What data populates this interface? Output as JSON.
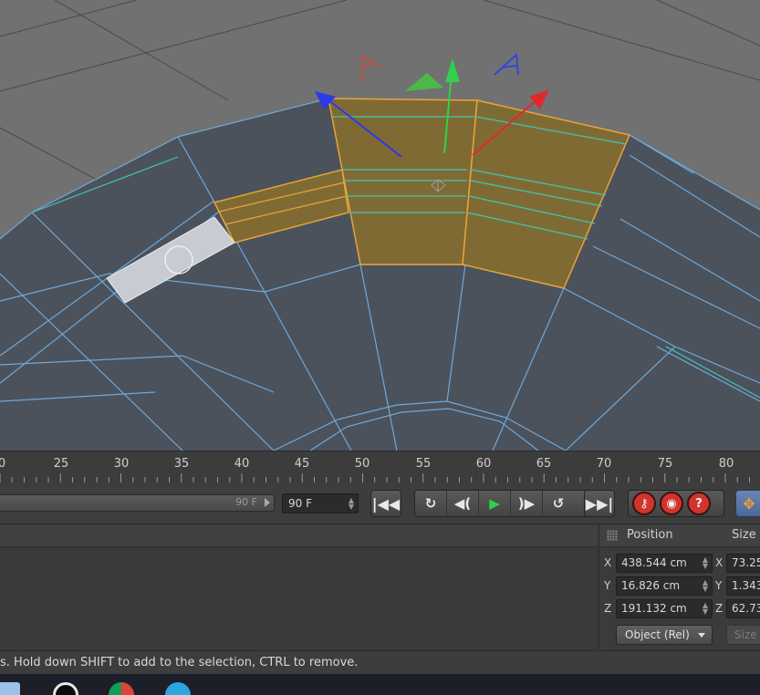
{
  "timeline": {
    "tick_labels": [
      "0",
      "25",
      "30",
      "35",
      "40",
      "45",
      "50",
      "55",
      "60",
      "65",
      "70",
      "75",
      "80"
    ]
  },
  "transport": {
    "slider_value": "90 F",
    "end_frame": "90 F",
    "buttons": {
      "goto_start": "goto-start-icon",
      "prev_key": "prev-keyframe-icon",
      "prev_frame": "prev-frame-icon",
      "play": "play-icon",
      "next_frame": "next-frame-icon",
      "next_key": "next-keyframe-icon",
      "goto_end": "goto-end-icon",
      "record": "record-key-icon",
      "autokey": "autokey-icon",
      "keyframe_selection": "keyframe-selection-icon",
      "move_tool": "move-tool-icon"
    }
  },
  "coordinates": {
    "position_label": "Position",
    "size_label": "Size",
    "rows": [
      {
        "axis": "X",
        "position": "438.544 cm",
        "size_axis": "X",
        "size": "73.25"
      },
      {
        "axis": "Y",
        "position": "16.826 cm",
        "size_axis": "Y",
        "size": "1.343"
      },
      {
        "axis": "Z",
        "position": "191.132 cm",
        "size_axis": "Z",
        "size": "62.73"
      }
    ],
    "mode_label": "Object (Rel)",
    "apply_label": "Size"
  },
  "status": {
    "message": "s. Hold down SHIFT to add to the selection, CTRL to remove."
  },
  "colors": {
    "selection": "#c99a2c",
    "wire": "#6fa8d8",
    "edge_loop": "#3fc6b4",
    "axis_x": "#e02a2a",
    "axis_y": "#2fd24a",
    "axis_z": "#2a3ae8"
  }
}
